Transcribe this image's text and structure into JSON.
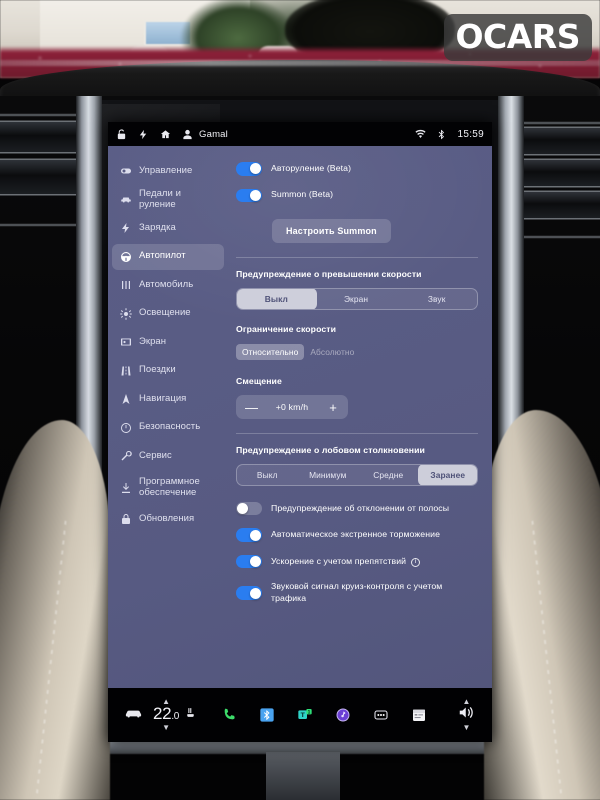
{
  "watermark": {
    "text": "OCARS"
  },
  "statusbar": {
    "icons_left": [
      "unlocked-icon",
      "charge-bolt-icon",
      "home-icon",
      "user-icon"
    ],
    "user": "Gamal",
    "icons_right": [
      "wifi-icon",
      "bluetooth-icon"
    ],
    "clock": "15:59"
  },
  "sidebar": {
    "items": [
      {
        "label": "Управление",
        "icon": "toggle-icon",
        "active": false
      },
      {
        "label": "Педали и руление",
        "icon": "car-icon",
        "active": false
      },
      {
        "label": "Зарядка",
        "icon": "bolt-icon",
        "active": false
      },
      {
        "label": "Автопилот",
        "icon": "steering-icon",
        "active": true
      },
      {
        "label": "Автомобиль",
        "icon": "sliders-icon",
        "active": false
      },
      {
        "label": "Освещение",
        "icon": "sun-icon",
        "active": false
      },
      {
        "label": "Экран",
        "icon": "display-icon",
        "active": false
      },
      {
        "label": "Поездки",
        "icon": "road-icon",
        "active": false
      },
      {
        "label": "Навигация",
        "icon": "navigation-icon",
        "active": false
      },
      {
        "label": "Безопасность",
        "icon": "shield-clock-icon",
        "active": false
      },
      {
        "label": "Сервис",
        "icon": "wrench-icon",
        "active": false
      },
      {
        "label": "Программное\nобеспечение",
        "icon": "download-icon",
        "active": false
      },
      {
        "label": "Обновления",
        "icon": "lock-icon",
        "active": false
      }
    ]
  },
  "content": {
    "autosteer_toggle": {
      "label": "Авторуление (Beta)",
      "on": true
    },
    "summon_toggle": {
      "label": "Summon (Beta)",
      "on": true
    },
    "summon_button": {
      "label": "Настроить Summon"
    },
    "speed_warning": {
      "title": "Предупреждение о превышении\nскорости",
      "options": [
        "Выкл",
        "Экран",
        "Звук"
      ],
      "selected": 0
    },
    "speed_limit": {
      "title": "Ограничение скорости",
      "options": [
        "Относительно",
        "Абсолютно"
      ],
      "selected": 0
    },
    "offset": {
      "title": "Смещение",
      "minus": "—",
      "value": "+0 km/h",
      "plus": "+"
    },
    "collision_warning": {
      "title": "Предупреждение о лобовом\nстолкновении",
      "options": [
        "Выкл",
        "Минимум",
        "Средне",
        "Заранее"
      ],
      "selected": 3
    },
    "bottom_toggles": [
      {
        "label": "Предупреждение об отклонении от полосы",
        "on": false,
        "info": false
      },
      {
        "label": "Автоматическое экстренное торможение",
        "on": true,
        "info": false
      },
      {
        "label": "Ускорение с учетом препятствий",
        "on": true,
        "info": true
      },
      {
        "label": "Звуковой сигнал круиз-контроля с учетом\nтрафика",
        "on": true,
        "info": false
      }
    ]
  },
  "taskbar": {
    "car_icon": "car-icon",
    "temperature": "22",
    "temperature_decimal": ".0",
    "seat_icon": "seat-heater-icon",
    "icons": [
      "phone-icon",
      "bluetooth-icon",
      "tidal-icon",
      "media-icon",
      "dots-icon",
      "calendar-icon"
    ],
    "volume_icon": "volume-icon"
  },
  "colors": {
    "panel_bg": "#575a82",
    "toggle_on": "#2a7df0",
    "selected_pill": "#ffffff",
    "text": "#ffffff"
  }
}
